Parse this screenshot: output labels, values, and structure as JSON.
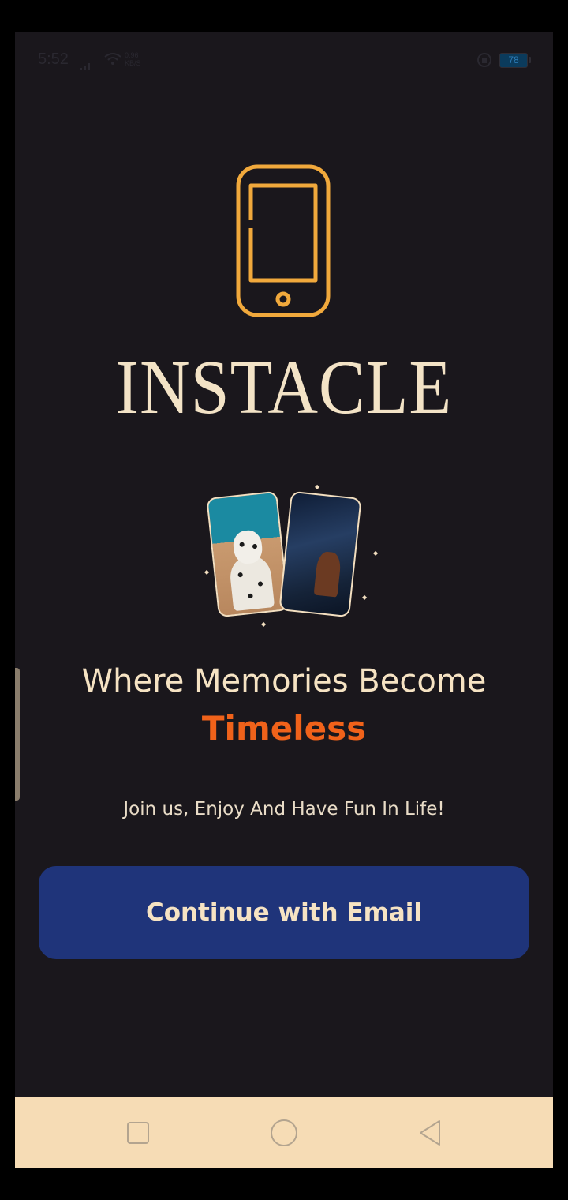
{
  "status_bar": {
    "time": "5:52",
    "net_speed_value": "0.96",
    "net_speed_unit": "KB/S",
    "battery": "78"
  },
  "brand": {
    "name": "INSTACLE",
    "logo_icon": "smartphone-icon",
    "logo_color": "#f1a93c"
  },
  "hero": {
    "headline": "Where Memories Become",
    "headline_accent": "Timeless",
    "accent_color": "#f0621a",
    "tagline": "Join us, Enjoy And Have Fun In Life!"
  },
  "cta": {
    "label": "Continue with Email",
    "color": "#1f347a"
  },
  "nav_bar": {
    "items": [
      "recents-square-icon",
      "home-circle-icon",
      "back-triangle-icon"
    ]
  }
}
